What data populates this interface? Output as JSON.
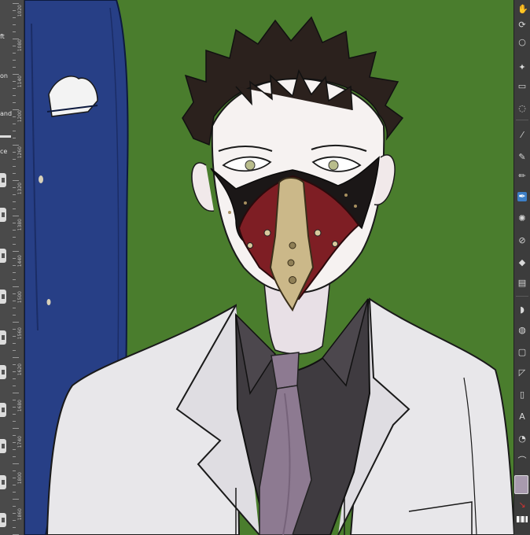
{
  "app": {
    "panel_labels": [
      "ft",
      "on",
      "and",
      "ce"
    ],
    "ruler_numbers": [
      "1020",
      "1080",
      "1140",
      "1200",
      "1260",
      "1320",
      "1380",
      "1440",
      "1500",
      "1560",
      "1620",
      "1680",
      "1740",
      "1800",
      "1860"
    ]
  },
  "colors": {
    "background": "#4a7d2d",
    "suit": "#e8e7ea",
    "shirt": "#3f3b40",
    "tie": "#8d7a91",
    "coat_blue": "#273f86",
    "hair": "#2b211d",
    "skin": "#f6f2f1",
    "mask_red": "#7e1e24",
    "mask_gold": "#cbb889",
    "current_color": "#a89aae"
  },
  "toolbar": {
    "tools": [
      "hand-icon",
      "rotate-icon",
      "zoom-icon",
      "move-icon",
      "select-icon",
      "eyedropper-icon",
      "pen-icon",
      "brush-icon",
      "airbrush-icon",
      "eraser-icon",
      "decoration-icon",
      "fill-icon",
      "gradient-icon",
      "shape-icon",
      "text-icon"
    ],
    "active_tool": "brush-icon"
  }
}
